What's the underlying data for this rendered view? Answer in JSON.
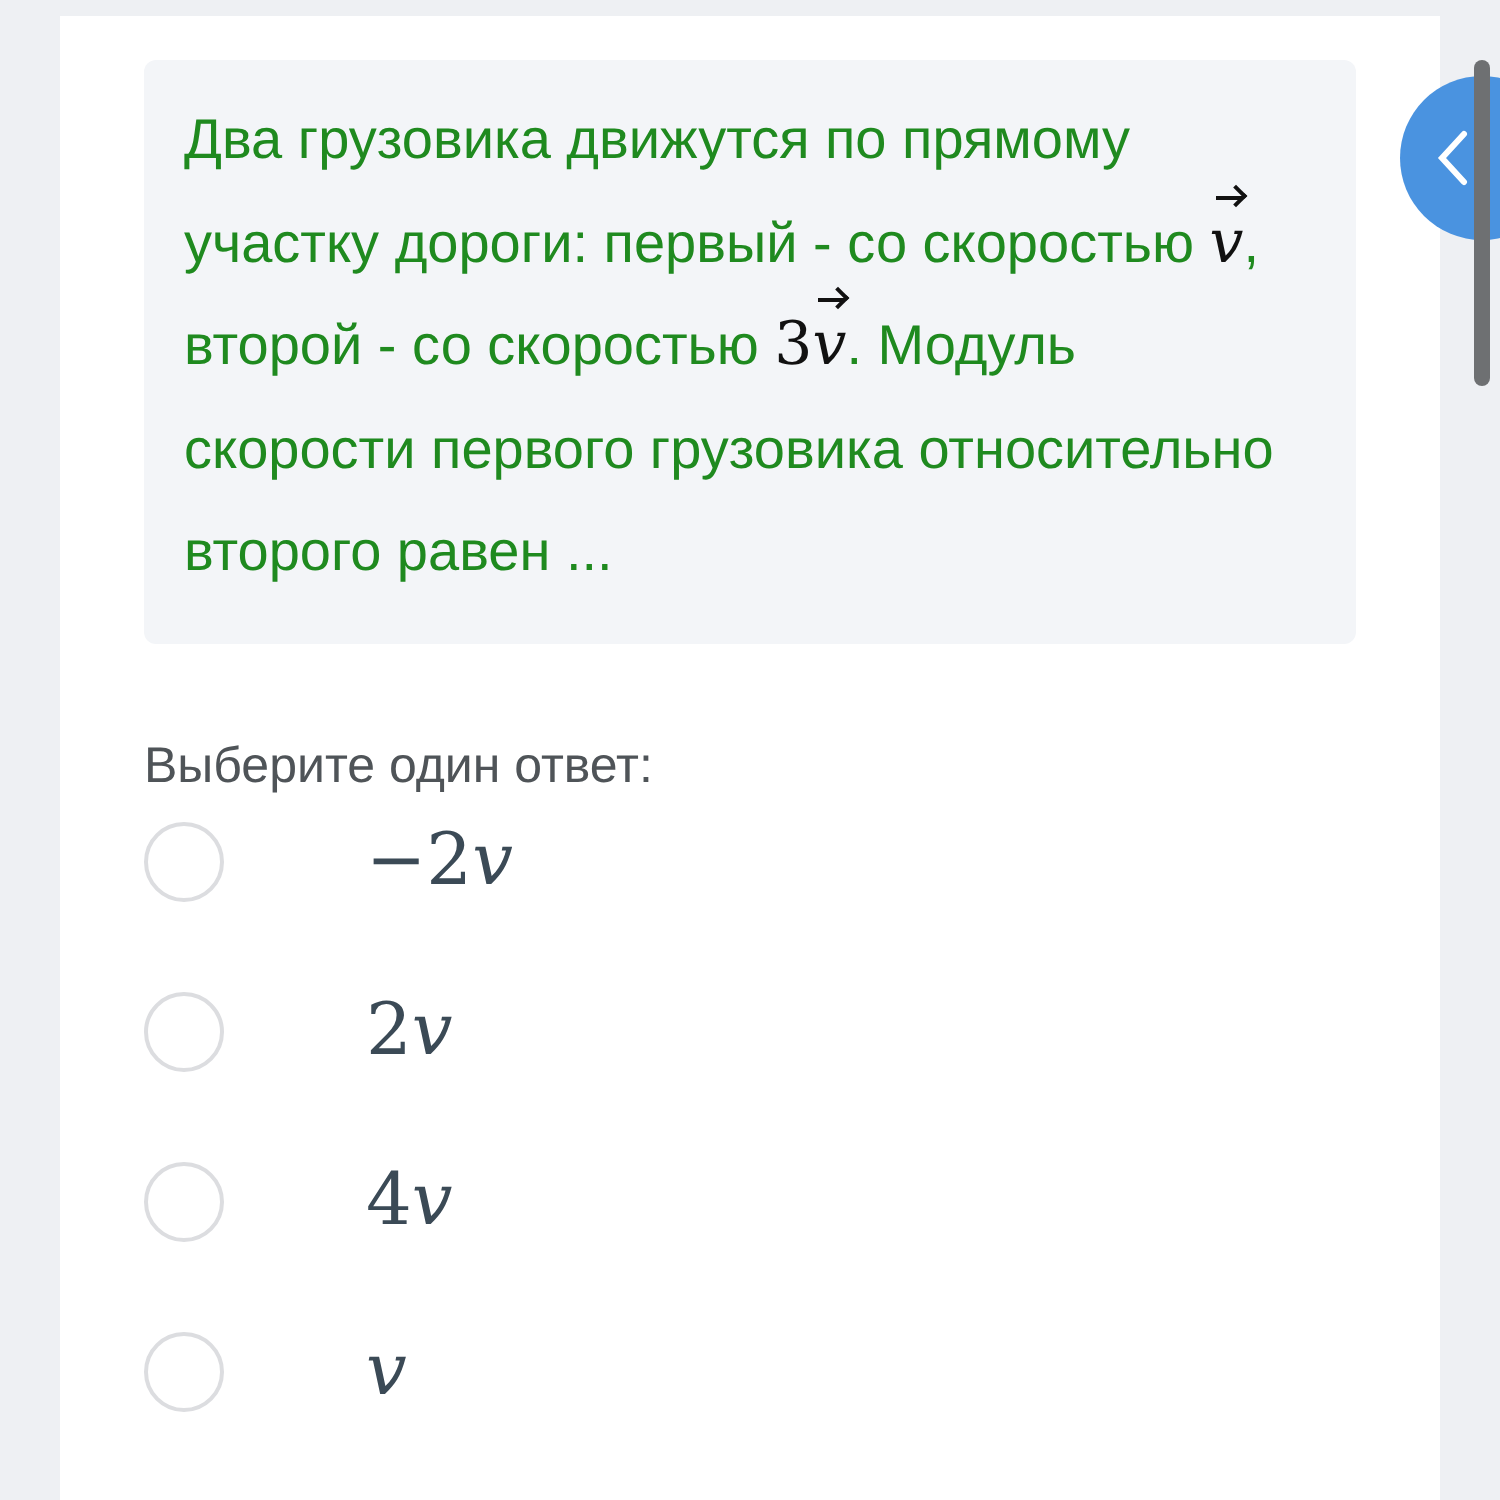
{
  "question": {
    "parts": [
      {
        "kind": "text",
        "text": "Два грузовика движутся по прямому участку дороги: первый - со скоростью "
      },
      {
        "kind": "vector",
        "text": "v"
      },
      {
        "kind": "text",
        "text": ", второй - со скоростью "
      },
      {
        "kind": "number",
        "text": "3"
      },
      {
        "kind": "vector",
        "text": "v"
      },
      {
        "kind": "text",
        "text": ". Модуль скорости первого грузовика относительно второго равен ..."
      }
    ]
  },
  "prompt": "Выберите один ответ:",
  "options": [
    {
      "coefficient": "−2",
      "variable": "v",
      "selected": false
    },
    {
      "coefficient": "2",
      "variable": "v",
      "selected": false
    },
    {
      "coefficient": "4",
      "variable": "v",
      "selected": false
    },
    {
      "variable": "v",
      "selected": false
    }
  ]
}
